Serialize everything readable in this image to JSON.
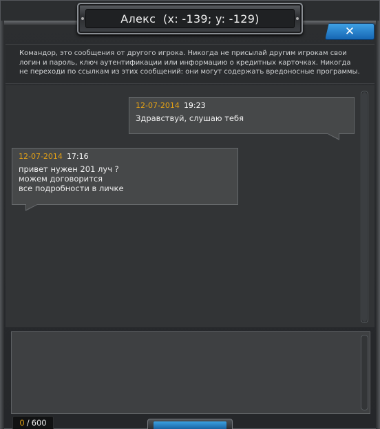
{
  "window": {
    "title": "Алекс  (x: -139; y: -129)"
  },
  "close_button": {
    "icon": "close-icon",
    "glyph": "✕"
  },
  "warning_text": "Командор, это сообщения от другого игрока. Никогда не присылай другим игрокам свои логин и пароль, ключ аутентификации или информацию о кредитных карточках. Никогда не переходи по ссылкам из этих сообщений: они могут содержать вредоносные программы.",
  "messages": [
    {
      "side": "right",
      "date": "12-07-2014",
      "time": "19:23",
      "text": "Здравствуй, слушаю тебя"
    },
    {
      "side": "left",
      "date": "12-07-2014",
      "time": "17:16",
      "text": "привет нужен 201 луч ?\nможем договорится\nвсе подробности в личке"
    }
  ],
  "compose": {
    "value": "",
    "char_count": "0",
    "separator": "/",
    "char_limit": "600"
  },
  "colors": {
    "accent_date": "#e5a215",
    "close_blue": "#1f7fcc"
  }
}
